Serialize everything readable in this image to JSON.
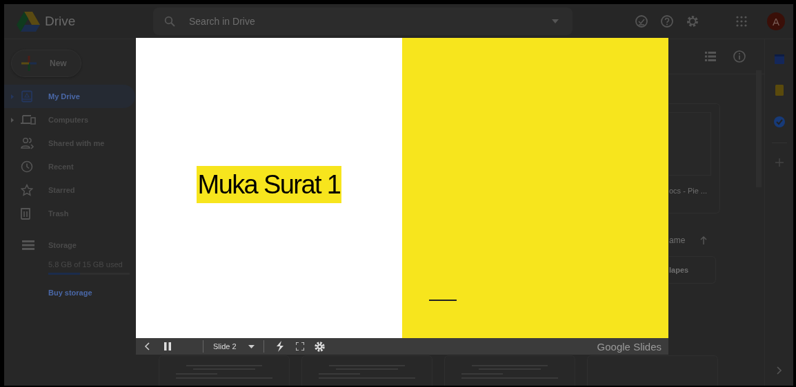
{
  "header": {
    "product": "Drive",
    "search": {
      "placeholder": "Search in Drive"
    },
    "avatar": "A"
  },
  "sidebar": {
    "new_button": "New",
    "items": [
      {
        "label": "My Drive",
        "kind": "drive",
        "expandable": true,
        "selected": true
      },
      {
        "label": "Computers",
        "kind": "computers",
        "expandable": true,
        "selected": false
      },
      {
        "label": "Shared with me",
        "kind": "shared",
        "expandable": false,
        "selected": false
      },
      {
        "label": "Recent",
        "kind": "recent",
        "expandable": false,
        "selected": false
      },
      {
        "label": "Starred",
        "kind": "starred",
        "expandable": false,
        "selected": false
      },
      {
        "label": "Trash",
        "kind": "trash",
        "expandable": false,
        "selected": false
      }
    ],
    "storage": {
      "label": "Storage",
      "usage": "5.8 GB of 15 GB used",
      "level": 0.39,
      "buy": "Buy storage"
    }
  },
  "main": {
    "card_caption": "ocs - Pie ...",
    "sort_label": "ame",
    "folder_chip": "lapes"
  },
  "presentation": {
    "slide_title": "Muka Surat 1",
    "slide_label": "Slide 2",
    "brand": "Google Slides"
  }
}
